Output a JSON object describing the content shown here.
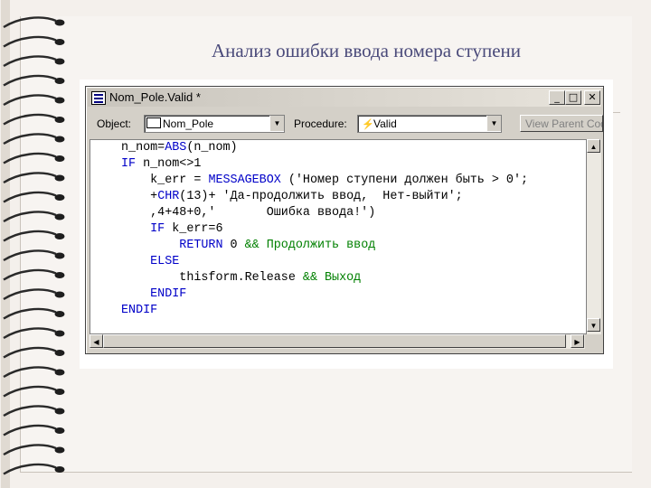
{
  "slide": {
    "title": "Анализ ошибки ввода номера ступени"
  },
  "window": {
    "title": "Nom_Pole.Valid *",
    "minimize": "_",
    "maximize": "□",
    "close": "✕"
  },
  "toolbar": {
    "object_label": "Object:",
    "object_value": "Nom_Pole",
    "procedure_label": "Procedure:",
    "procedure_value": "Valid",
    "view_parent_label": "View Parent Cod"
  },
  "code_lines": [
    [
      {
        "t": "n_nom=",
        "c": "tx"
      },
      {
        "t": "ABS",
        "c": "kw"
      },
      {
        "t": "(n_nom)",
        "c": "tx"
      }
    ],
    [
      {
        "t": "IF ",
        "c": "kw"
      },
      {
        "t": "n_nom<>1",
        "c": "tx"
      }
    ],
    [
      {
        "t": "    k_err = ",
        "c": "tx"
      },
      {
        "t": "MESSAGEBOX ",
        "c": "kw"
      },
      {
        "t": "('Номер ступени должен быть > 0';",
        "c": "tx"
      }
    ],
    [
      {
        "t": "    +",
        "c": "tx"
      },
      {
        "t": "CHR",
        "c": "kw"
      },
      {
        "t": "(13)+ 'Да-продолжить ввод,  Нет-выйти';",
        "c": "tx"
      }
    ],
    [
      {
        "t": "    ,4+48+0,'       Ошибка ввода!')",
        "c": "tx"
      }
    ],
    [
      {
        "t": "    IF ",
        "c": "kw"
      },
      {
        "t": "k_err=6",
        "c": "tx"
      }
    ],
    [
      {
        "t": "        RETURN ",
        "c": "kw"
      },
      {
        "t": "0 ",
        "c": "tx"
      },
      {
        "t": "&& Продолжить ввод",
        "c": "cm"
      }
    ],
    [
      {
        "t": "    ELSE",
        "c": "kw"
      }
    ],
    [
      {
        "t": "        thisform.Release ",
        "c": "tx"
      },
      {
        "t": "&& Выход",
        "c": "cm"
      }
    ],
    [
      {
        "t": "    ENDIF",
        "c": "kw"
      }
    ],
    [
      {
        "t": "ENDIF",
        "c": "kw"
      }
    ]
  ],
  "colors": {
    "keyword": "#0000c8",
    "text": "#000000",
    "comment": "#008000"
  },
  "icons": {
    "spiral_binding": "spiral-binding",
    "window_icon": "code-window-icon",
    "object_icon": "textbox-icon",
    "procedure_icon": "lightning-icon"
  }
}
